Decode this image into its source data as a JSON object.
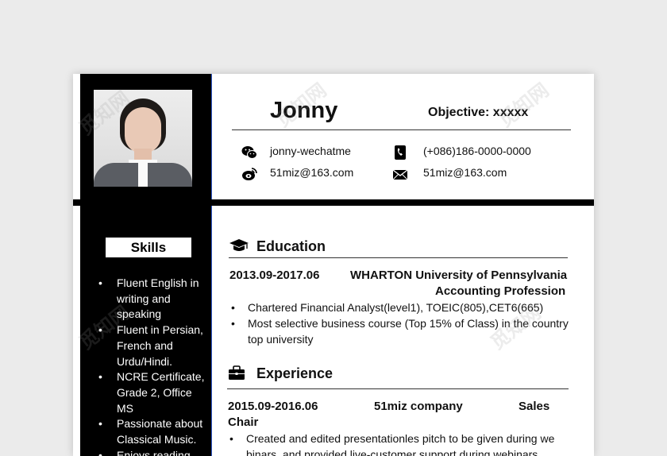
{
  "header": {
    "name": "Jonny",
    "objective": "Objective: xxxxx"
  },
  "contacts": {
    "wechat": "jonny-wechatme",
    "phone": "(+086)186-0000-0000",
    "weibo": "51miz@163.com",
    "email": "51miz@163.com"
  },
  "icons": {
    "wechat": "wechat-icon",
    "phone": "phone-icon",
    "weibo": "weibo-icon",
    "email": "mail-icon",
    "education": "graduation-cap-icon",
    "experience": "briefcase-icon"
  },
  "skills": {
    "title": "Skills",
    "items": [
      "Fluent English in writing and speaking",
      "Fluent in Persian, French and Urdu/Hindi.",
      "NCRE Certificate, Grade 2, Office MS",
      "Passionate about Classical Music.",
      "Enjoys reading"
    ]
  },
  "education": {
    "title": "Education",
    "period": "2013.09-2017.06",
    "school": "WHARTON University of Pennsylvania",
    "major": "Accounting Profession",
    "bullets": [
      "Chartered Financial Analyst(level1), TOEIC(805),CET6(665)",
      "Most selective business course (Top 15% of Class) in the country top university"
    ]
  },
  "experience": {
    "title": "Experience",
    "period": "2015.09-2016.06",
    "company": "51miz company",
    "role_a": "Sales",
    "role_b": "Chair",
    "bullets": [
      "Created and edited presentationles pitch to be given during we binars, and provided live-customer support during webinars"
    ]
  },
  "watermark": "觅知网",
  "colors": {
    "sidebar": "#000000",
    "accent_line": "#2f57c8",
    "background": "#ebebeb"
  }
}
